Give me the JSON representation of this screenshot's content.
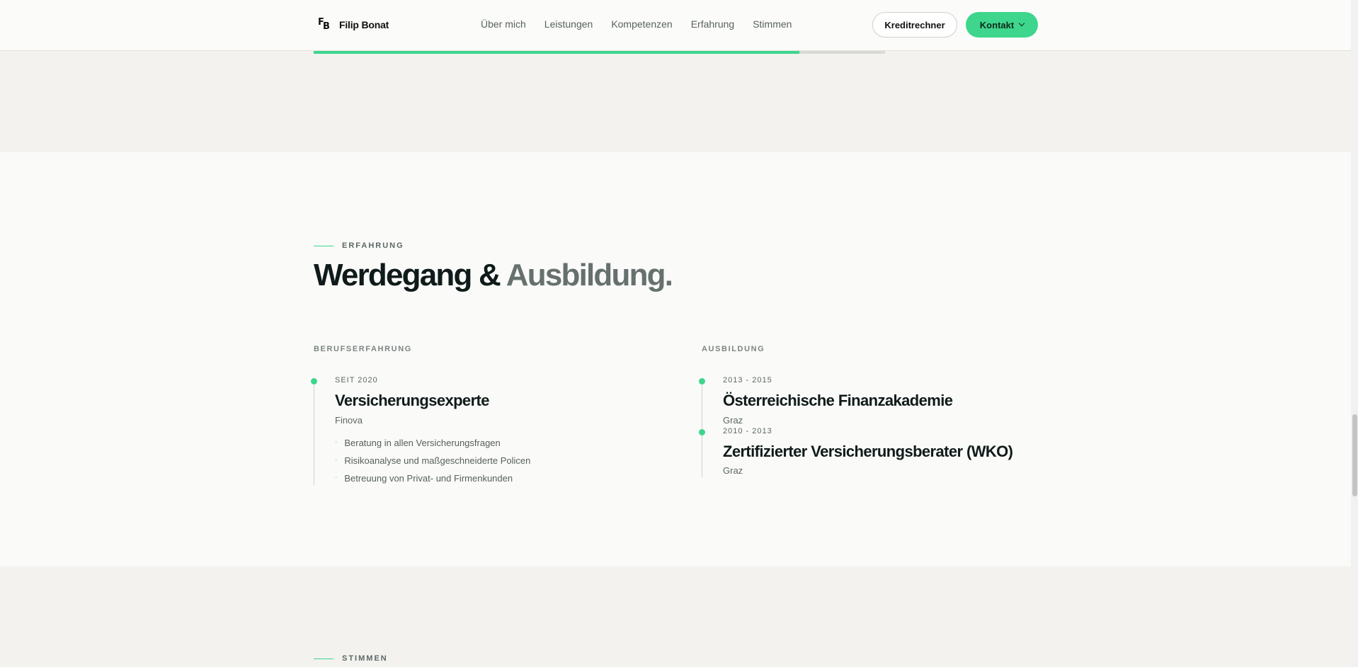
{
  "brand": {
    "logo_letters": [
      "F",
      "B"
    ],
    "name": "Filip Bonat"
  },
  "nav": {
    "links": [
      "Über mich",
      "Leistungen",
      "Kompetenzen",
      "Erfahrung",
      "Stimmen"
    ],
    "credit_button": "Kreditrechner",
    "contact_button": "Kontakt"
  },
  "scroll_progress_percent": 85,
  "experience_section": {
    "eyebrow": "ERFAHRUNG",
    "heading_main": "Werdegang &",
    "heading_accent": "Ausbildung.",
    "work": {
      "label": "BERUFSERFAHRUNG",
      "items": [
        {
          "period": "SEIT 2020",
          "title": "Versicherungsexperte",
          "company": "Finova",
          "bullets": [
            "Beratung in allen Versicherungsfragen",
            "Risikoanalyse und maßgeschneiderte Policen",
            "Betreuung von Privat- und Firmenkunden"
          ]
        }
      ]
    },
    "education": {
      "label": "AUSBILDUNG",
      "items": [
        {
          "period": "2013 - 2015",
          "title": "Österreichische Finanzakademie",
          "place": "Graz"
        },
        {
          "period": "2010 - 2013",
          "title": "Zertifizierter Versicherungsberater (WKO)",
          "place": "Graz"
        }
      ]
    }
  },
  "next_section": {
    "eyebrow": "STIMMEN"
  },
  "colors": {
    "accent": "#3dd68c",
    "heading": "#0f1b1a",
    "muted": "#66716f"
  }
}
